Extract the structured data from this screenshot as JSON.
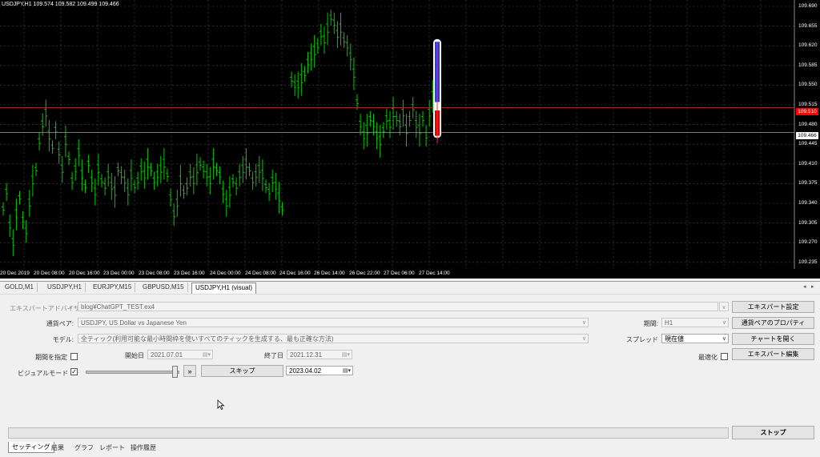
{
  "chart": {
    "symbol_info": "USDJPY,H1  109.574 109.582 109.499 109.466",
    "price_labels": [
      "109.690",
      "109.655",
      "109.620",
      "109.585",
      "109.550",
      "109.515",
      "109.480",
      "109.445",
      "109.410",
      "109.375",
      "109.340",
      "109.305",
      "109.270",
      "109.235"
    ],
    "ask_price": "109.510",
    "bid_price": "109.466",
    "time_labels": [
      "20 Dec 2019",
      "20 Dec 08:00",
      "20 Dec 16:00",
      "23 Dec 00:00",
      "23 Dec 08:00",
      "23 Dec 16:00",
      "24 Dec 00:00",
      "24 Dec 08:00",
      "24 Dec 16:00",
      "26 Dec 14:00",
      "26 Dec 22:00",
      "27 Dec 06:00",
      "27 Dec 14:00"
    ],
    "colors": {
      "background": "#000000",
      "bars": "#00c800",
      "grid": "#4a4a4a",
      "ask_line": "#ff0000"
    }
  },
  "tabs": {
    "items": [
      "GOLD,M1",
      "USDJPY,H1",
      "EURJPY,M15",
      "GBPUSD,M15",
      "USDJPY,H1 (visual)"
    ],
    "active_index": 4
  },
  "tester": {
    "expert_label": "エキスパートアドバイザ",
    "expert_value": "blog¥ChatGPT_TEST.ex4",
    "pair_label": "通貨ペア:",
    "pair_value": "USDJPY, US Dollar vs Japanese Yen",
    "model_label": "モデル:",
    "model_value": "全ティック(利用可能な最小時間枠を使いすべてのティックを生成する、最も正確な方法)",
    "period_label": "期間:",
    "period_value": "H1",
    "spread_label": "スプレッド",
    "spread_value": "現在値",
    "use_date_label": "期間を指定",
    "start_label": "開始日",
    "start_value": "2021.07.01",
    "end_label": "終了日",
    "end_value": "2021.12.31",
    "optimize_label": "最適化",
    "visual_label": "ビジュアルモード",
    "skip_label": "スキップ",
    "skip_date": "2023.04.02",
    "expert_settings_btn": "エキスパート設定",
    "pair_props_btn": "通貨ペアのプロパティ",
    "open_chart_btn": "チャートを開く",
    "expert_edit_btn": "エキスパート編集",
    "stop_btn": "ストップ",
    "visual_checked": true
  },
  "bottom_tabs": {
    "items": [
      "セッティング",
      "結果",
      "グラフ",
      "レポート",
      "操作履歴"
    ],
    "active_index": 0
  }
}
